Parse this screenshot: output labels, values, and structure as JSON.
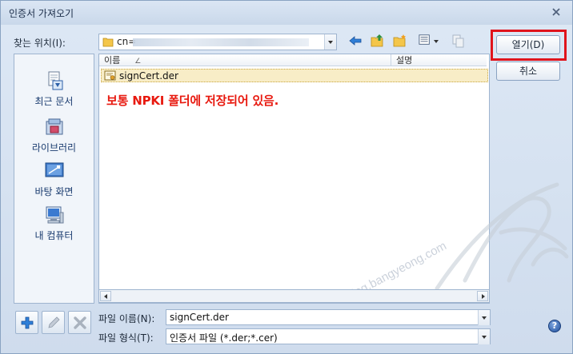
{
  "window": {
    "title": "인증서 가져오기"
  },
  "lookin": {
    "label": "찾는 위치(I):",
    "path": "cn="
  },
  "places": [
    {
      "label": "최근 문서",
      "icon": "recent-documents-icon"
    },
    {
      "label": "라이브러리",
      "icon": "library-icon"
    },
    {
      "label": "바탕 화면",
      "icon": "desktop-icon"
    },
    {
      "label": "내 컴퓨터",
      "icon": "my-computer-icon"
    }
  ],
  "filelist": {
    "columns": [
      "이름",
      "설명"
    ],
    "sort_indicator": "∠",
    "files": [
      {
        "name": "signCert.der",
        "icon": "certificate-file-icon",
        "selected": true
      }
    ]
  },
  "note": "보통 NPKI 폴더에 저장되어 있음.",
  "watermark": "blog.bangyeong.com",
  "fields": {
    "filename": {
      "label": "파일 이름(N):",
      "value": "signCert.der"
    },
    "filetype": {
      "label": "파일 형식(T):",
      "value": "인증서 파일 (*.der;*.cer)"
    }
  },
  "buttons": {
    "open": "열기(D)",
    "cancel": "취소",
    "help": "?"
  },
  "colors": {
    "highlight_red": "#e0141c",
    "note_red": "#e8190f",
    "selection": "#f8edc7"
  }
}
